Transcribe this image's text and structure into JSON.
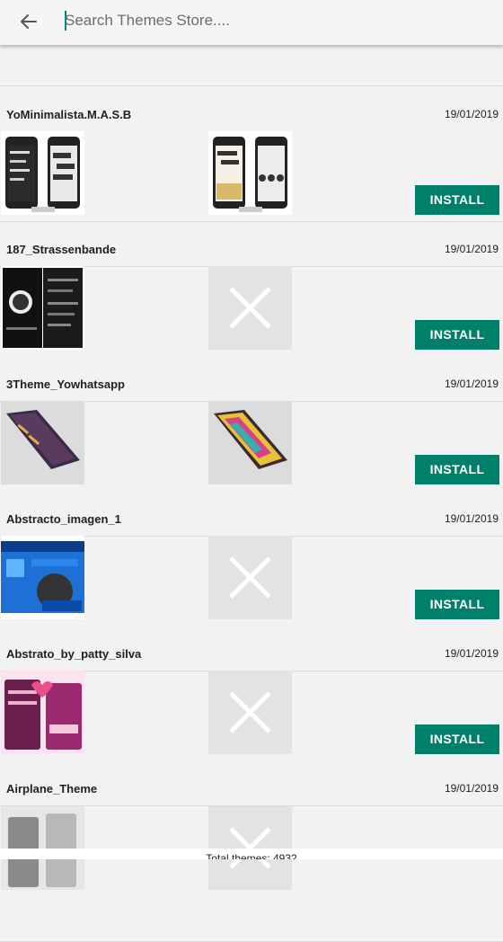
{
  "search": {
    "placeholder": "Search Themes Store...."
  },
  "install_label": "INSTALL",
  "themes": [
    {
      "name": "",
      "date": "",
      "thumb1": "preview",
      "thumb2": "preview"
    },
    {
      "name": "YoMinimalista.M.A.S.B",
      "date": "19/01/2019",
      "thumb1": "preview",
      "thumb2": "preview"
    },
    {
      "name": "187_Strassenbande",
      "date": "19/01/2019",
      "thumb1": "preview",
      "thumb2": "missing"
    },
    {
      "name": "3Theme_Yowhatsapp",
      "date": "19/01/2019",
      "thumb1": "preview",
      "thumb2": "preview"
    },
    {
      "name": "Abstracto_imagen_1",
      "date": "19/01/2019",
      "thumb1": "preview",
      "thumb2": "missing"
    },
    {
      "name": "Abstrato_by_patty_silva",
      "date": "19/01/2019",
      "thumb1": "preview",
      "thumb2": "missing"
    },
    {
      "name": "Airplane_Theme",
      "date": "19/01/2019",
      "thumb1": "preview",
      "thumb2": "missing"
    }
  ],
  "footer": {
    "total": "Total themes: 4932"
  },
  "colors": {
    "accent": "#00806a",
    "background": "#f2f2f2",
    "placeholder_thumb": "#e3e3e3"
  }
}
